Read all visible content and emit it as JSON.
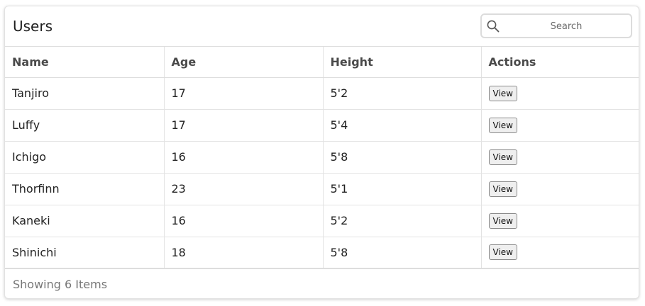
{
  "header": {
    "title": "Users"
  },
  "search": {
    "placeholder": "Search",
    "value": ""
  },
  "table": {
    "columns": [
      "Name",
      "Age",
      "Height",
      "Actions"
    ],
    "rows": [
      {
        "name": "Tanjiro",
        "age": "17",
        "height": "5'2",
        "action": "View"
      },
      {
        "name": "Luffy",
        "age": "17",
        "height": "5'4",
        "action": "View"
      },
      {
        "name": "Ichigo",
        "age": "16",
        "height": "5'8",
        "action": "View"
      },
      {
        "name": "Thorfinn",
        "age": "23",
        "height": "5'1",
        "action": "View"
      },
      {
        "name": "Kaneki",
        "age": "16",
        "height": "5'2",
        "action": "View"
      },
      {
        "name": "Shinichi",
        "age": "18",
        "height": "5'8",
        "action": "View"
      }
    ]
  },
  "footer": {
    "status": "Showing 6 Items"
  },
  "icons": {
    "search": "search-icon"
  }
}
